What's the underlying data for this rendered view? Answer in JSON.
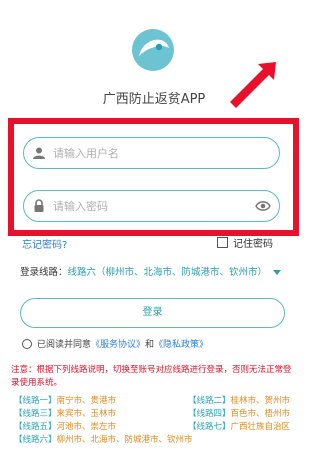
{
  "app": {
    "title": "广西防止返贫APP"
  },
  "login": {
    "username_placeholder": "请输入用户名",
    "password_placeholder": "请输入密码",
    "forgot_label": "忘记密码?",
    "remember_label": "记住密码",
    "route_label": "登录线路：",
    "route_value": "线路六（柳州市、北海市、防城港市、钦州市）",
    "login_label": "登录"
  },
  "agreement": {
    "prefix": "已阅读并同意",
    "service_link": "《服务协议》",
    "and": "和",
    "privacy_link": "《隐私政策》"
  },
  "notice": "注意：根据下列线路说明，切换至账号对应线路进行登录，否则无法正常登录使用系统。",
  "lines": [
    {
      "name": "【线路一】",
      "cities": "南宁市、贵港市"
    },
    {
      "name": "【线路二】",
      "cities": "桂林市、贺州市"
    },
    {
      "name": "【线路三】",
      "cities": "来宾市、玉林市"
    },
    {
      "name": "【线路四】",
      "cities": "百色市、梧州市"
    },
    {
      "name": "【线路五】",
      "cities": "河池市、崇左市"
    },
    {
      "name": "【线路七】",
      "cities": "广西壮族自治区"
    },
    {
      "name": "【线路六】",
      "cities": "柳州市、北海市、防城港市、钦州市"
    }
  ],
  "colors": {
    "accent": "#2a9db0",
    "link": "#2d7fe0",
    "alert": "#e8102a",
    "annotation": "#e8102a"
  },
  "icons": {
    "logo": "app-logo-icon",
    "user": "user-icon",
    "lock": "lock-icon",
    "eye": "eye-icon",
    "arrow": "annotation-arrow-icon"
  }
}
